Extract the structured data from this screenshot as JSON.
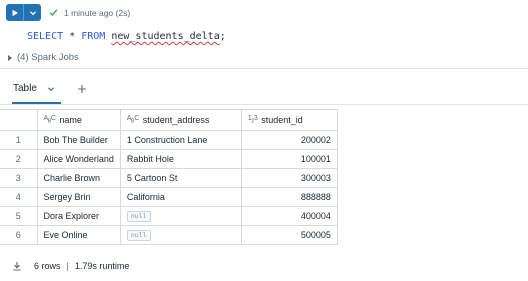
{
  "cell": {
    "run_icon": "play-icon",
    "menu_icon": "chevron-down-icon",
    "status_icon": "check-icon",
    "status_text": "1 minute ago (2s)",
    "code": {
      "kw1": "SELECT",
      "star": "*",
      "kw2": "FROM",
      "table": "new_students_delta",
      "semicolon": ";"
    },
    "spark_jobs": "(4) Spark Jobs"
  },
  "tabs": {
    "active": "Table",
    "add_icon": "plus-icon"
  },
  "grid": {
    "columns": [
      {
        "type": "ABC",
        "name": "name"
      },
      {
        "type": "ABC",
        "name": "student_address"
      },
      {
        "type": "123",
        "name": "student_id"
      }
    ],
    "rows": [
      {
        "idx": "1",
        "name": "Bob The Builder",
        "address": "1 Construction Lane",
        "id": "200002"
      },
      {
        "idx": "2",
        "name": "Alice Wonderland",
        "address": "Rabbit Hole",
        "id": "100001"
      },
      {
        "idx": "3",
        "name": "Charlie Brown",
        "address": "5 Cartoon St",
        "id": "300003"
      },
      {
        "idx": "4",
        "name": "Sergey Brin",
        "address": "California",
        "id": "888888"
      },
      {
        "idx": "5",
        "name": "Dora Explorer",
        "address": "null",
        "id": "400004"
      },
      {
        "idx": "6",
        "name": "Eve Online",
        "address": "null",
        "id": "500005"
      }
    ]
  },
  "footer": {
    "download_icon": "download-icon",
    "rows": "6 rows",
    "separator": "|",
    "runtime": "1.79s runtime"
  },
  "colors": {
    "accent": "#2272b4",
    "success": "#3ba65e"
  }
}
